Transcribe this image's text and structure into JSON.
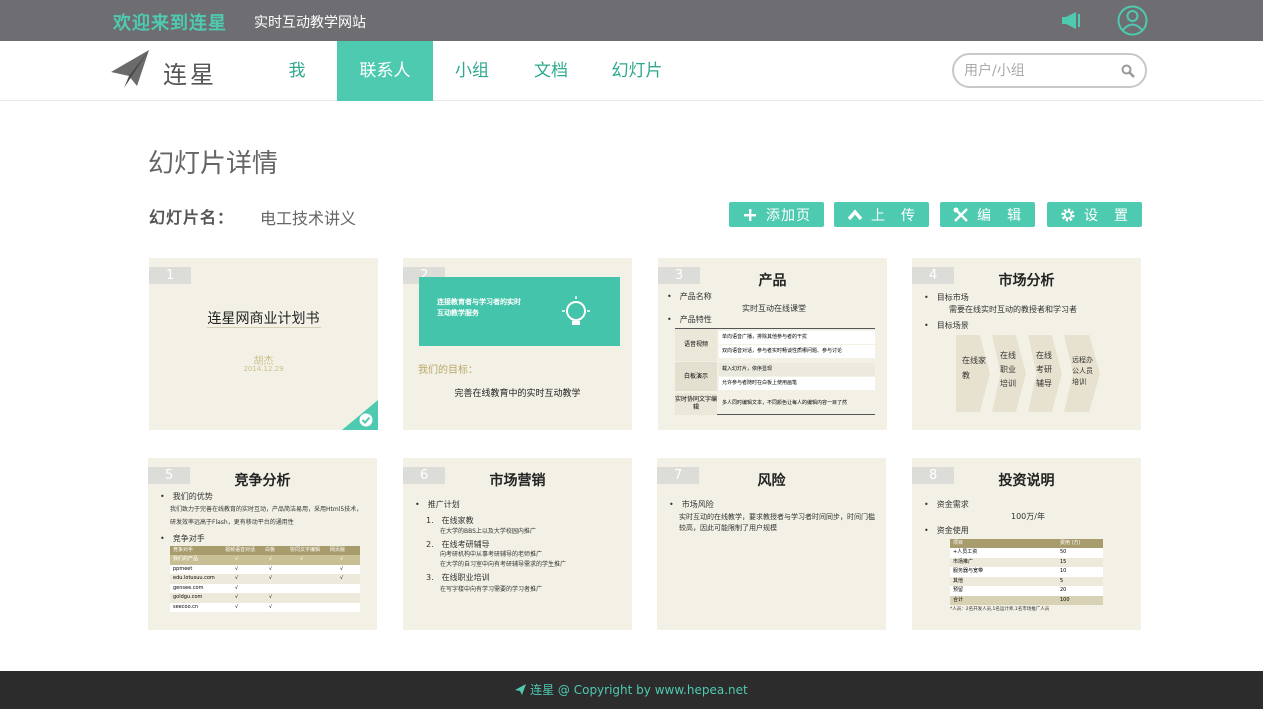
{
  "topbar": {
    "welcome": "欢迎来到连星",
    "subtitle": "实时互动教学网站"
  },
  "nav": {
    "logo": "连星",
    "items": [
      {
        "label": "我",
        "active": false
      },
      {
        "label": "联系人",
        "active": true
      },
      {
        "label": "小组",
        "active": false
      },
      {
        "label": "文档",
        "active": false
      },
      {
        "label": "幻灯片",
        "active": false
      }
    ],
    "search_placeholder": "用户/小组"
  },
  "page": {
    "title": "幻灯片详情",
    "name_label": "幻灯片名：",
    "name_value": "电工技术讲义",
    "buttons": {
      "add": "添加页",
      "upload": "上　传",
      "edit": "编　辑",
      "settings": "设　置"
    }
  },
  "slides": {
    "s1": {
      "num": "1",
      "title": "连星网商业计划书",
      "author": "胡杰",
      "date": "2014.12.29"
    },
    "s2": {
      "num": "2",
      "banner": "连接教育者与学习者的实时互动教学服务",
      "goal_label": "我们的目标：",
      "goal": "完善在线教育中的实时互动教学"
    },
    "s3": {
      "num": "3",
      "title": "产品",
      "b1": "产品名称",
      "name": "实时互动在线课堂",
      "b2": "产品特性",
      "rows": [
        {
          "k": "语音视频",
          "v1": "单向语音广播，排除其他参与者的干扰",
          "v2": "双向语音对话，参与者实时畅谈性质哪问题、参与讨论"
        },
        {
          "k": "白板演示",
          "v1": "载入幻灯片，依序显现",
          "v2": "允许参与者随时在白板上使用画笔"
        },
        {
          "k": "实时协同文字编辑",
          "v1": "多人同时编辑文本，不同颜色让每人的编辑内容一目了然",
          "v2": ""
        }
      ]
    },
    "s4": {
      "num": "4",
      "title": "市场分析",
      "b1": "目标市场",
      "market": "需要在线实时互动的教授者和学习者",
      "b2": "目标场景",
      "scenes": [
        "在线家教",
        "在线职业培训",
        "在线考研辅导",
        "远程办公人员培训"
      ]
    },
    "s5": {
      "num": "5",
      "title": "竞争分析",
      "b1": "我们的优势",
      "adv": "我们致力于完善在线教育的实时互动，产品简洁易用，采用Html5技术，研发效率远高于Flash，更有移动平台的通用性",
      "b2": "竞争对手",
      "headers": [
        "竞争对手",
        "视频语音对话",
        "白板",
        "协同文字编辑",
        "网页版"
      ],
      "rows": [
        [
          "我们的产品",
          "√",
          "√",
          "√",
          "√"
        ],
        [
          "ppmeet",
          "√",
          "√",
          "",
          "√"
        ],
        [
          "edu.lotusuu.com",
          "√",
          "√",
          "",
          "√"
        ],
        [
          "gensee.com",
          "√",
          "",
          "",
          ""
        ],
        [
          "goldgu.com",
          "√",
          "√",
          "",
          ""
        ],
        [
          "seecoo.cn",
          "√",
          "√",
          "",
          ""
        ]
      ]
    },
    "s6": {
      "num": "6",
      "title": "市场营销",
      "b1": "推广计划",
      "items": [
        {
          "h": "1.　在线家教",
          "d": "在大学的BBS上以及大学校园内推广"
        },
        {
          "h": "2.　在线考研辅导",
          "d": "向考研机构中从事考研辅导的老师推广\n在大学的自习室中向有考研辅导需求的学生推广"
        },
        {
          "h": "3.　在线职业培训",
          "d": "在写字楼中向有学习需要的学习者推广"
        }
      ]
    },
    "s7": {
      "num": "7",
      "title": "风险",
      "b1": "市场风险",
      "text": "实时互动的在线教学，要求教授者与学习者时间同步，时间门槛较高，因此可能限制了用户规模"
    },
    "s8": {
      "num": "8",
      "title": "投资说明",
      "b1": "资金需求",
      "amount": "100万/年",
      "b2": "资金使用",
      "headers": [
        "项目",
        "费用 (万)"
      ],
      "rows": [
        [
          "+人员工资",
          "50"
        ],
        [
          "市场推广",
          "15"
        ],
        [
          "服务器与宽带",
          "10"
        ],
        [
          "其他",
          "5"
        ],
        [
          "预留",
          "20"
        ],
        [
          "合计",
          "100"
        ]
      ],
      "note": "*人员：2名开发人员,1名运计师,1名市场推广人员"
    }
  },
  "footer": {
    "text": "连星 @ Copyright by www.hepea.net"
  },
  "colors": {
    "accent": "#4ecab0",
    "topbar": "#6e6d71",
    "footer": "#2c2c2c"
  }
}
